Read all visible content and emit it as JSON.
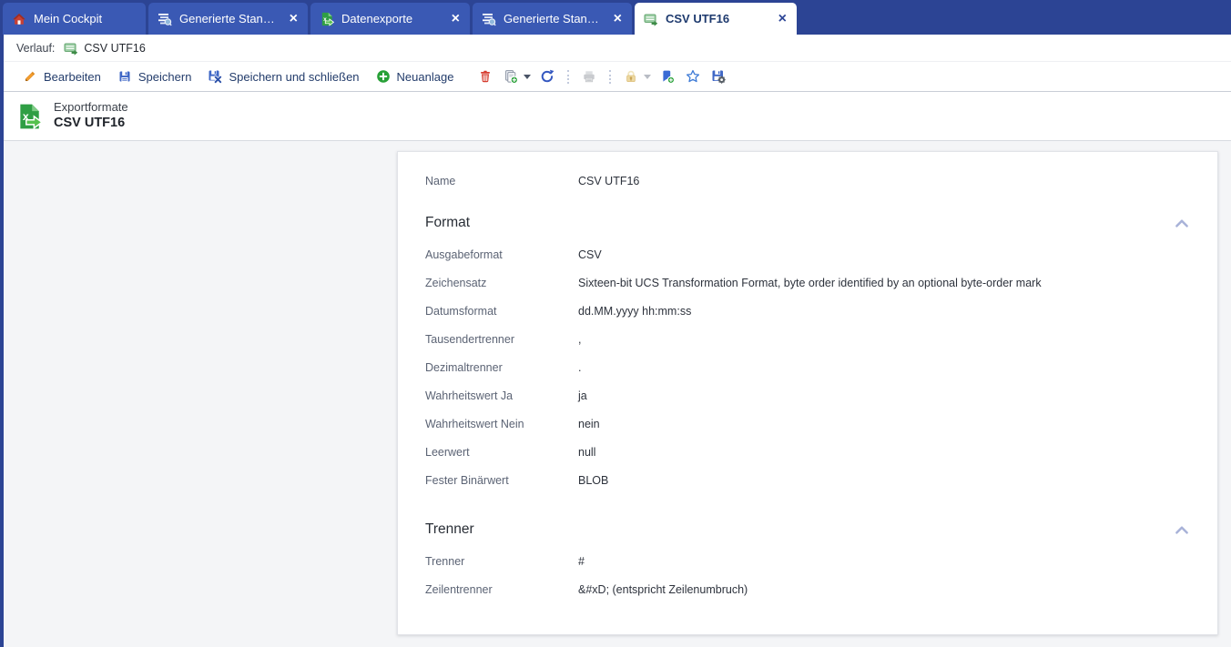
{
  "tabbar": {
    "tabs": [
      {
        "label": "Mein Cockpit",
        "icon": "home-icon",
        "active": false,
        "closable": false
      },
      {
        "label": "Generierte Standar...",
        "icon": "list-search-icon",
        "active": false,
        "closable": true
      },
      {
        "label": "Datenexporte",
        "icon": "export-document-icon",
        "active": false,
        "closable": true
      },
      {
        "label": "Generierte Standar...",
        "icon": "list-search-icon",
        "active": false,
        "closable": true
      },
      {
        "label": "CSV UTF16",
        "icon": "table-export-icon",
        "active": true,
        "closable": true
      }
    ],
    "close_glyph": "×"
  },
  "history": {
    "label": "Verlauf:",
    "item": "CSV UTF16",
    "item_icon": "table-export-icon"
  },
  "toolbar": {
    "edit": "Bearbeiten",
    "save": "Speichern",
    "save_close": "Speichern und schließen",
    "new": "Neuanlage",
    "icon_buttons": [
      "trash-icon",
      "copy-add-icon",
      "refresh-icon",
      "printer-icon",
      "lock-icon",
      "bookmark-add-icon",
      "star-icon",
      "save-gear-icon"
    ],
    "disabled_buttons": [
      "printer-icon",
      "lock-icon"
    ]
  },
  "header": {
    "category": "Exportformate",
    "title": "CSV UTF16",
    "icon": "excel-export-icon"
  },
  "form": {
    "name": {
      "label": "Name",
      "value": "CSV UTF16"
    },
    "sections": [
      {
        "title": "Format",
        "collapse_icon": "chevron-up-icon",
        "fields": [
          {
            "label": "Ausgabeformat",
            "value": "CSV"
          },
          {
            "label": "Zeichensatz",
            "value": "Sixteen-bit UCS Transformation Format, byte order identified by an optional byte-order mark"
          },
          {
            "label": "Datumsformat",
            "value": "dd.MM.yyyy hh:mm:ss"
          },
          {
            "label": "Tausendertrenner",
            "value": ","
          },
          {
            "label": "Dezimaltrenner",
            "value": "."
          },
          {
            "label": "Wahrheitswert Ja",
            "value": "ja"
          },
          {
            "label": "Wahrheitswert Nein",
            "value": "nein"
          },
          {
            "label": "Leerwert",
            "value": "null"
          },
          {
            "label": "Fester Binärwert",
            "value": "BLOB"
          }
        ]
      },
      {
        "title": "Trenner",
        "collapse_icon": "chevron-up-icon",
        "fields": [
          {
            "label": "Trenner",
            "value": "#"
          },
          {
            "label": "Zeilentrenner",
            "value": "&#xD; (entspricht Zeilenumbruch)"
          }
        ]
      }
    ]
  },
  "colors": {
    "tabbar_bg": "#2c4494",
    "tab_bg": "#3a59b4",
    "active_tab_text": "#1e3a6e",
    "toolbar_text": "#233c6b",
    "accent_green": "#27a037",
    "accent_red": "#d63c2f",
    "lock_tan": "#edd9a2",
    "content_bg": "#f4f5f7",
    "label_text": "#5b6374",
    "value_text": "#2d323c",
    "chevron": "#a8b2d8"
  }
}
